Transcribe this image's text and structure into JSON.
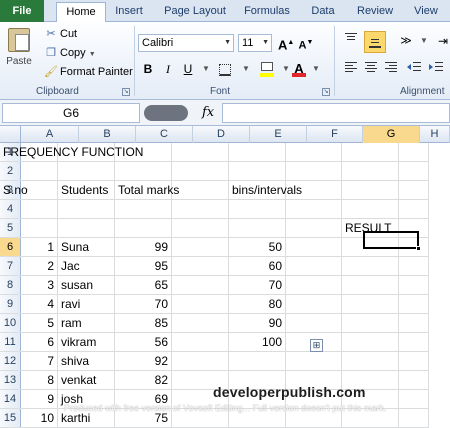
{
  "tabs": {
    "file": "File",
    "home": "Home",
    "insert": "Insert",
    "page_layout": "Page Layout",
    "formulas": "Formulas",
    "data": "Data",
    "review": "Review",
    "view": "View"
  },
  "ribbon": {
    "clipboard": {
      "paste": "Paste",
      "cut": "Cut",
      "copy": "Copy",
      "format_painter": "Format Painter",
      "label": "Clipboard"
    },
    "font": {
      "name": "Calibri",
      "size": "11",
      "bold": "B",
      "italic": "I",
      "underline": "U",
      "grow": "A",
      "shrink": "A",
      "label": "Font",
      "font_color": "#e0262b",
      "fill_color": "#ffff00"
    },
    "alignment": {
      "label": "Alignment"
    }
  },
  "formula_bar": {
    "name_box": "G6",
    "fx": "fx",
    "formula": ""
  },
  "columns": [
    "A",
    "B",
    "C",
    "D",
    "E",
    "F",
    "G",
    "H"
  ],
  "selected_column": "G",
  "selected_row": "6",
  "rows": [
    {
      "n": "1",
      "A": "FREQUENCY FUNCTION",
      "B": "",
      "C": "",
      "D": "",
      "E": "",
      "F": "",
      "G": ""
    },
    {
      "n": "2",
      "A": "",
      "B": "",
      "C": "",
      "D": "",
      "E": "",
      "F": "",
      "G": ""
    },
    {
      "n": "3",
      "A": "S.no",
      "B": "Students",
      "C": "Total marks",
      "D": "",
      "E": "bins/intervals",
      "F": "",
      "G": ""
    },
    {
      "n": "4",
      "A": "",
      "B": "",
      "C": "",
      "D": "",
      "E": "",
      "F": "",
      "G": ""
    },
    {
      "n": "5",
      "A": "",
      "B": "",
      "C": "",
      "D": "",
      "E": "",
      "F": "",
      "G": "RESULT"
    },
    {
      "n": "6",
      "A": "1",
      "B": "Suna",
      "C": "99",
      "D": "",
      "E": "50",
      "F": "",
      "G": ""
    },
    {
      "n": "7",
      "A": "2",
      "B": "Jac",
      "C": "95",
      "D": "",
      "E": "60",
      "F": "",
      "G": ""
    },
    {
      "n": "8",
      "A": "3",
      "B": "susan",
      "C": "65",
      "D": "",
      "E": "70",
      "F": "",
      "G": ""
    },
    {
      "n": "9",
      "A": "4",
      "B": "ravi",
      "C": "70",
      "D": "",
      "E": "80",
      "F": "",
      "G": ""
    },
    {
      "n": "10",
      "A": "5",
      "B": "ram",
      "C": "85",
      "D": "",
      "E": "90",
      "F": "",
      "G": ""
    },
    {
      "n": "11",
      "A": "6",
      "B": "vikram",
      "C": "56",
      "D": "",
      "E": "100",
      "F": "",
      "G": ""
    },
    {
      "n": "12",
      "A": "7",
      "B": "shiva",
      "C": "92",
      "D": "",
      "E": "",
      "F": "",
      "G": ""
    },
    {
      "n": "13",
      "A": "8",
      "B": "venkat",
      "C": "82",
      "D": "",
      "E": "",
      "F": "",
      "G": ""
    },
    {
      "n": "14",
      "A": "9",
      "B": "josh",
      "C": "69",
      "D": "",
      "E": "",
      "F": "",
      "G": ""
    },
    {
      "n": "15",
      "A": "10",
      "B": "karthi",
      "C": "75",
      "D": "",
      "E": "",
      "F": "",
      "G": ""
    }
  ],
  "watermark": {
    "site": "developerpublish.com",
    "note": "Produced with free version of Vovsoft Editing... Full version doesn't put this mark."
  }
}
